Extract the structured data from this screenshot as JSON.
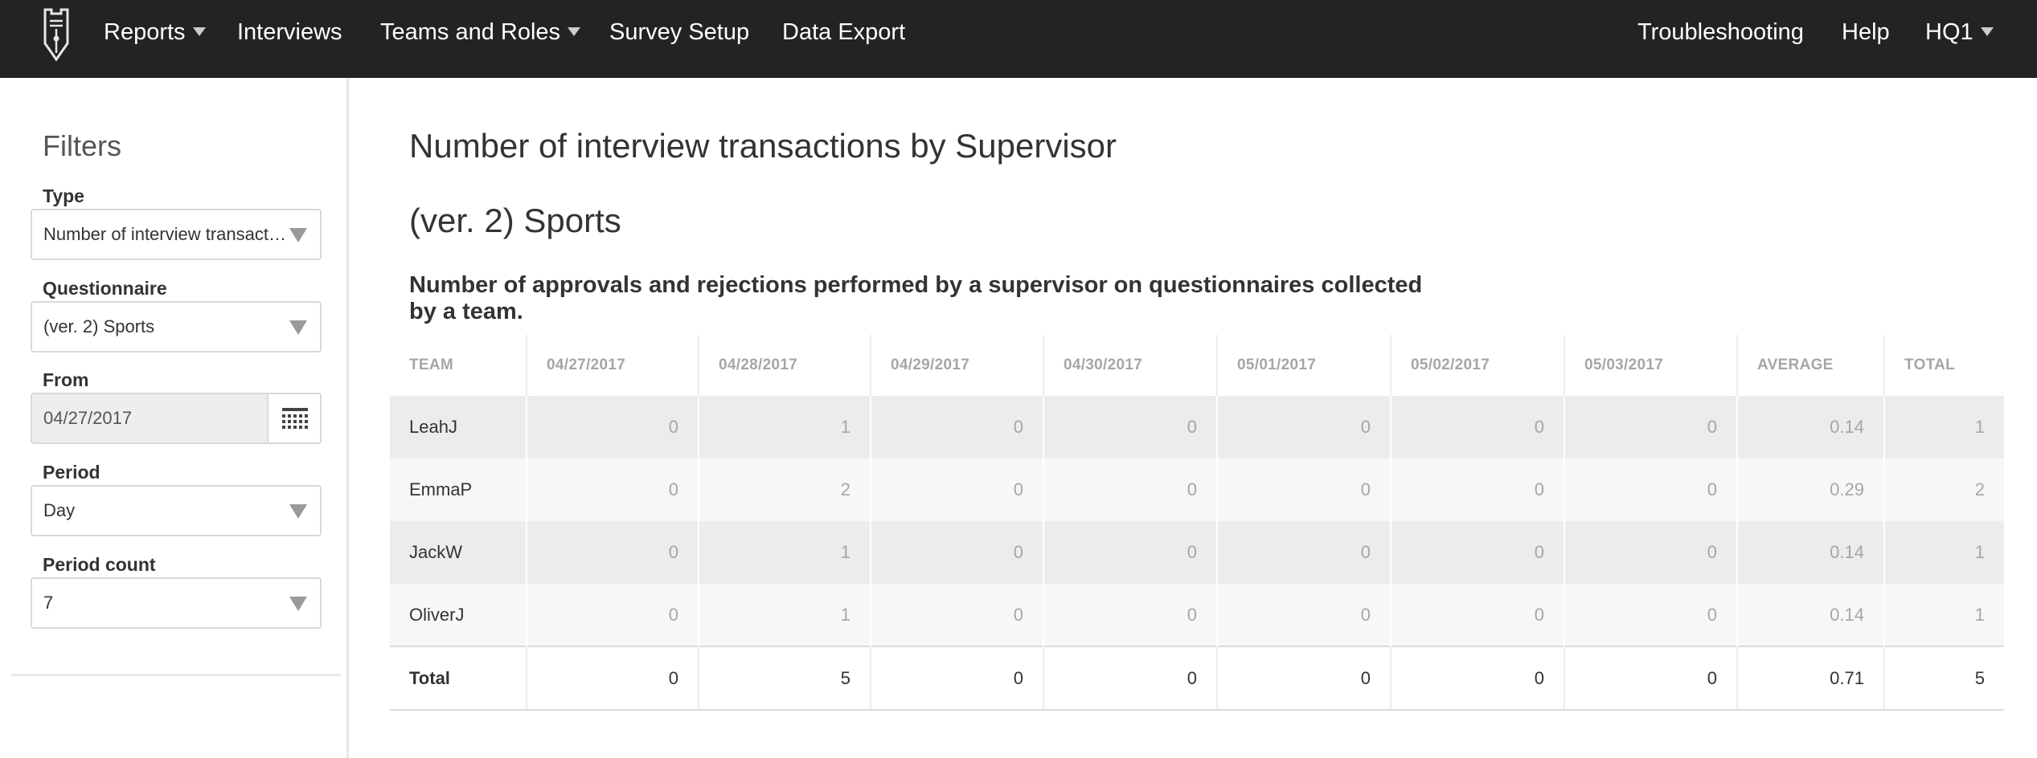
{
  "navbar": {
    "logo": "pen-nib-logo-icon",
    "left_items": [
      {
        "label": "Reports",
        "has_dropdown": true
      },
      {
        "label": "Interviews",
        "has_dropdown": false
      },
      {
        "label": "Teams and Roles",
        "has_dropdown": true
      },
      {
        "label": "Survey Setup",
        "has_dropdown": false
      },
      {
        "label": "Data Export",
        "has_dropdown": false
      }
    ],
    "right_items": [
      {
        "label": "Troubleshooting",
        "has_dropdown": false
      },
      {
        "label": "Help",
        "has_dropdown": false
      },
      {
        "label": "HQ1",
        "has_dropdown": true
      }
    ]
  },
  "filters": {
    "title": "Filters",
    "type": {
      "label": "Type",
      "value": "Number of interview transactions by Supervisor"
    },
    "questionnaire": {
      "label": "Questionnaire",
      "value": "(ver. 2) Sports"
    },
    "from": {
      "label": "From",
      "value": "04/27/2017",
      "icon": "calendar-icon"
    },
    "period": {
      "label": "Period",
      "value": "Day"
    },
    "period_count": {
      "label": "Period count",
      "value": "7"
    }
  },
  "report": {
    "title": "Number of interview transactions by Supervisor",
    "subtitle": "(ver. 2) Sports",
    "description": "Number of approvals and rejections performed by a supervisor on questionnaires collected by a team.",
    "table": {
      "headers": [
        "TEAM",
        "04/27/2017",
        "04/28/2017",
        "04/29/2017",
        "04/30/2017",
        "05/01/2017",
        "05/02/2017",
        "05/03/2017",
        "AVERAGE",
        "TOTAL"
      ],
      "rows": [
        [
          "LeahJ",
          "0",
          "1",
          "0",
          "0",
          "0",
          "0",
          "0",
          "0.14",
          "1"
        ],
        [
          "EmmaP",
          "0",
          "2",
          "0",
          "0",
          "0",
          "0",
          "0",
          "0.29",
          "2"
        ],
        [
          "JackW",
          "0",
          "1",
          "0",
          "0",
          "0",
          "0",
          "0",
          "0.14",
          "1"
        ],
        [
          "OliverJ",
          "0",
          "1",
          "0",
          "0",
          "0",
          "0",
          "0",
          "0.14",
          "1"
        ]
      ],
      "footer": [
        "Total",
        "0",
        "5",
        "0",
        "0",
        "0",
        "0",
        "0",
        "0.71",
        "5"
      ]
    }
  }
}
